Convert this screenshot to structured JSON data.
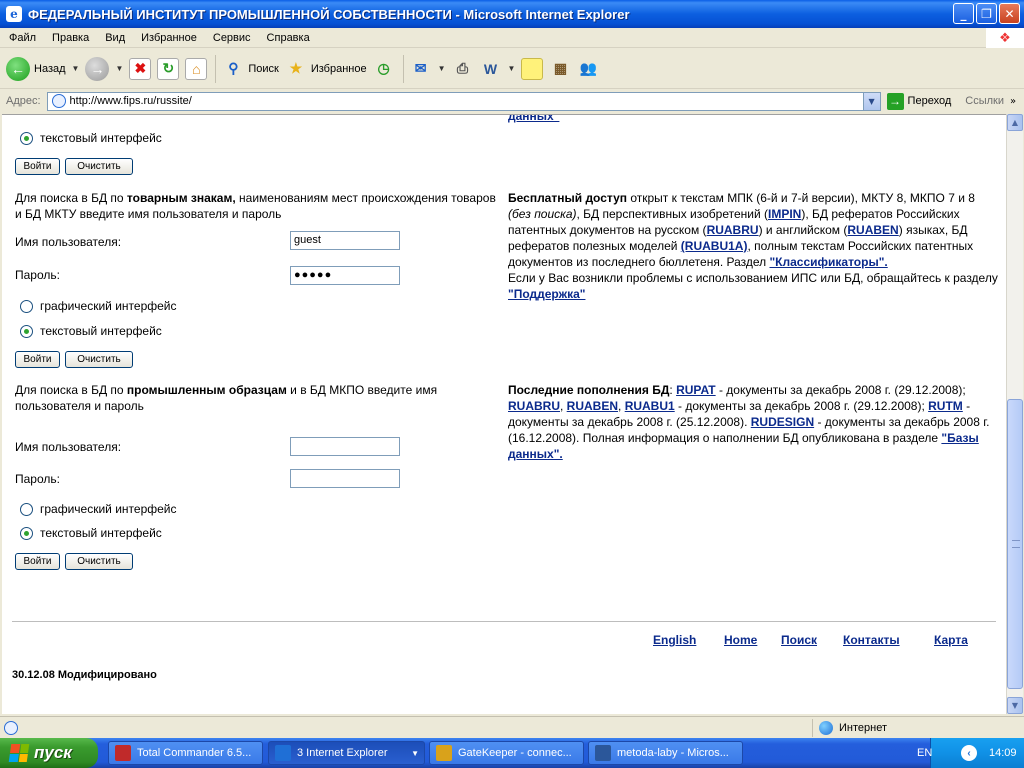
{
  "window": {
    "title": "ФЕДЕРАЛЬНЫЙ ИНСТИТУТ ПРОМЫШЛЕННОЙ СОБСТВЕННОСТИ - Microsoft Internet Explorer",
    "minimize": "_",
    "maximize": "❐",
    "close": "✕"
  },
  "menu": [
    "Файл",
    "Правка",
    "Вид",
    "Избранное",
    "Сервис",
    "Справка"
  ],
  "toolbar": {
    "back": "Назад",
    "search": "Поиск",
    "favorites": "Избранное"
  },
  "address": {
    "label": "Адрес:",
    "url": "http://www.fips.ru/russite/",
    "go": "Переход",
    "links": "Ссылки"
  },
  "left": {
    "top_radio_text": "текстовый интерфейс",
    "login": "Войти",
    "clear": "Очистить",
    "tm": {
      "intro_pre": "Для поиска в БД по ",
      "intro_bold": "товарным знакам,",
      "intro_post": " наименованиям мест происхождения товаров и БД МКТУ введите имя пользователя и пароль",
      "user_label": "Имя пользователя:",
      "user_value": "guest",
      "pass_label": "Пароль:",
      "pass_value": "●●●●●",
      "graphic": "графический интерфейс",
      "text": "текстовый интерфейс"
    },
    "id": {
      "intro_pre": "Для поиска в БД по ",
      "intro_bold": "промышленным образцам",
      "intro_post": " и в БД МКПО введите имя пользователя и пароль",
      "user_label": "Имя пользователя:",
      "user_value": "",
      "pass_label": "Пароль:",
      "pass_value": "",
      "graphic": "графический интерфейс",
      "text": "текстовый интерфейс"
    }
  },
  "right": {
    "cut_link": "данных\"",
    "free": {
      "bold": "Бесплатный доступ",
      "t1": " открыт к текстам МПК (6-й и 7-й версии), МКТУ 8, МКПО 7 и 8 ",
      "t1_italic": "(без поиска)",
      "t2": ", БД перспективных изобретений (",
      "impin": "IMPIN",
      "t3": "), БД рефератов Российских патентных документов на русском (",
      "ruabru": "RUABRU",
      "t4": ") и английском (",
      "ruaben": "RUABEN",
      "t5": ") языках, БД рефератов полезных моделей ",
      "ruabu1a": "(RUABU1A)",
      "t6": ", полным текстам Российских патентных документов из последнего бюллетеня.  Раздел ",
      "classif": "\"Классификаторы\".",
      "t7": "Если у Вас возникли проблемы с использованием ИПС или БД, обращайтесь к разделу ",
      "support": "\"Поддержка\""
    },
    "latest": {
      "bold": "Последние пополнения БД",
      "t0": ": ",
      "rupat": "RUPAT",
      "t1": " - документы за декабрь 2008 г. (29.12.2008); ",
      "ruabru": "RUABRU",
      "c1": ", ",
      "ruaben": "RUABEN",
      "c2": ",  ",
      "ruabu1": "RUABU1",
      "t2": " - документы за декабрь 2008 г. (29.12.2008); ",
      "rutm": "RUTM",
      "t3": " - документы за декабрь 2008 г. (25.12.2008). ",
      "rudesign": "RUDESIGN",
      "t4": " - документы за декабрь 2008 г. (16.12.2008). Полная информация о наполнении БД опубликована в разделе ",
      "db": "\"Базы данных\"."
    }
  },
  "footer": {
    "links": [
      "English",
      "Home",
      "Поиск",
      "Контакты",
      "Карта"
    ],
    "modified": "30.12.08 Модифицировано"
  },
  "status": {
    "zone": "Интернет"
  },
  "taskbar": {
    "start": "пуск",
    "tasks": [
      {
        "label": "Total Commander 6.5...",
        "color": "#c02a2a"
      },
      {
        "label": "3 Internet Explorer",
        "color": "#1f6fd6"
      },
      {
        "label": "GateKeeper - connec...",
        "color": "#d9a21b"
      },
      {
        "label": "metoda-laby - Micros...",
        "color": "#2b579a"
      }
    ],
    "lang": "EN",
    "clock": "14:09"
  }
}
